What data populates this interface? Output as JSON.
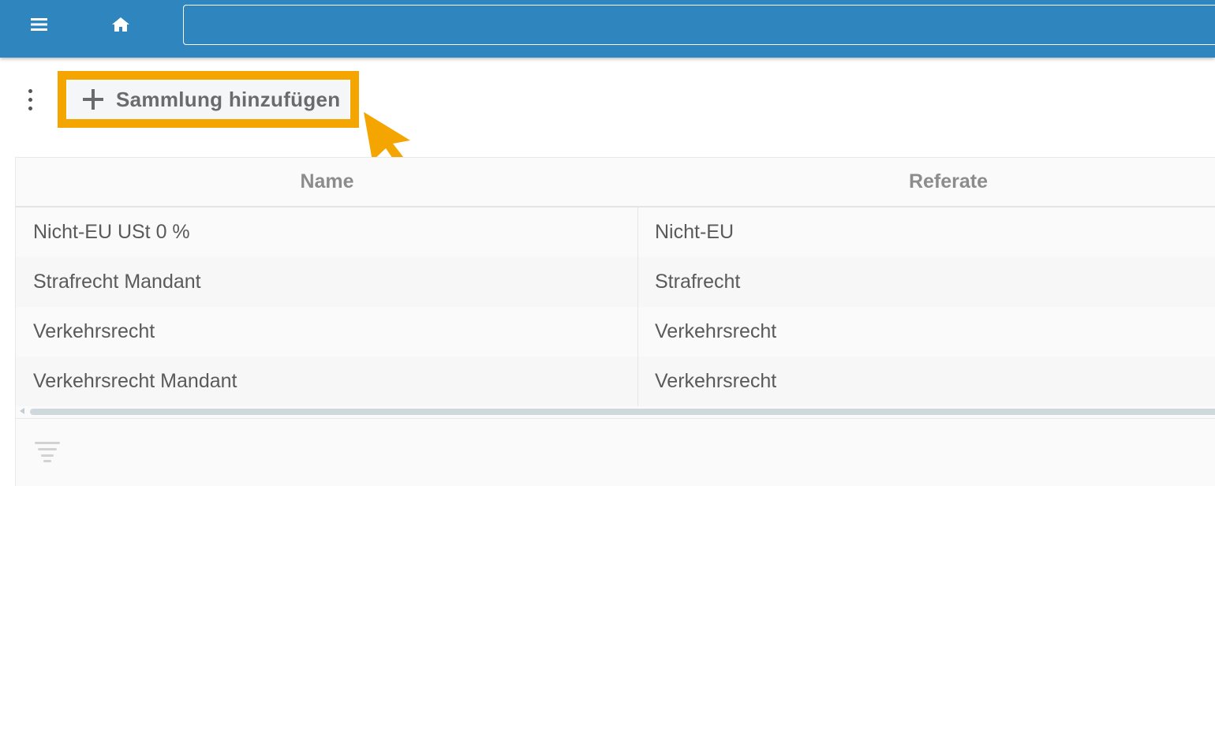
{
  "topbar": {
    "menu_icon": "hamburger-menu-icon",
    "home_icon": "home-icon",
    "search": {
      "value": "",
      "placeholder": ""
    },
    "background_color": "#2f86bf"
  },
  "toolbar": {
    "more_icon": "kebab-menu-icon",
    "add_button": {
      "icon": "plus-icon",
      "label": "Sammlung hinzufügen"
    },
    "highlight_color": "#f5a500"
  },
  "grid": {
    "columns": [
      {
        "key": "name",
        "label": "Name"
      },
      {
        "key": "referate",
        "label": "Referate"
      }
    ],
    "rows": [
      {
        "name": "Nicht-EU USt 0 %",
        "referate": "Nicht-EU"
      },
      {
        "name": "Strafrecht Mandant",
        "referate": "Strafrecht"
      },
      {
        "name": "Verkehrsrecht",
        "referate": "Verkehrsrecht"
      },
      {
        "name": "Verkehrsrecht Mandant",
        "referate": "Verkehrsrecht"
      }
    ],
    "footer": {
      "filter_icon": "filter-icon"
    }
  },
  "annotation": {
    "cursor_icon": "pointer-arrow-icon"
  }
}
